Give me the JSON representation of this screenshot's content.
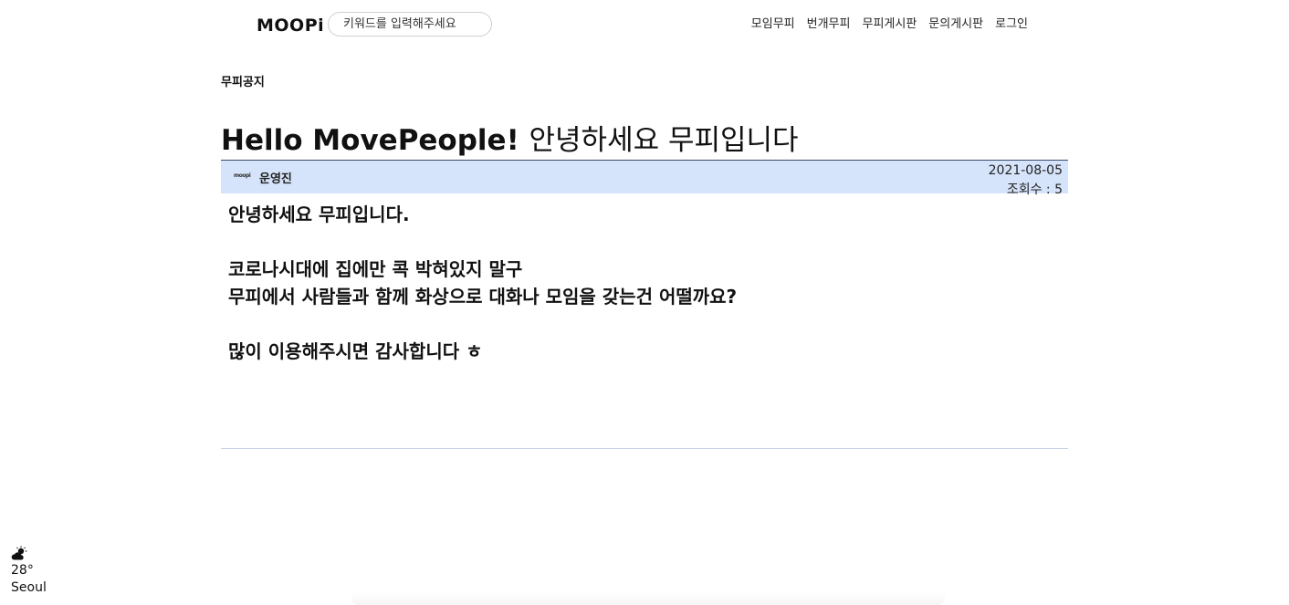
{
  "header": {
    "logo": "MOOPi",
    "search_placeholder": "키워드를 입력해주세요",
    "nav": [
      "모임무피",
      "번개무피",
      "무피게시판",
      "문의게시판",
      "로그인"
    ]
  },
  "breadcrumb": "무피공지",
  "post": {
    "title_en": "Hello MovePeople!",
    "title_ko": "안녕하세요 무피입니다",
    "author": "운영진",
    "avatar_text": "moopi",
    "date": "2021-08-05",
    "views": "조회수 : 5",
    "body": [
      "안녕하세요 무피입니다.",
      "",
      "코로나시대에 집에만 콕 박혀있지 말구",
      "무피에서 사람들과 함께 화상으로 대화나 모임을 갖는건 어떨까요?",
      "",
      "많이 이용해주시면 감사합니다 ㅎ"
    ]
  },
  "weather": {
    "icon": "cloud-sun-icon",
    "temp": "28°",
    "city": "Seoul"
  }
}
